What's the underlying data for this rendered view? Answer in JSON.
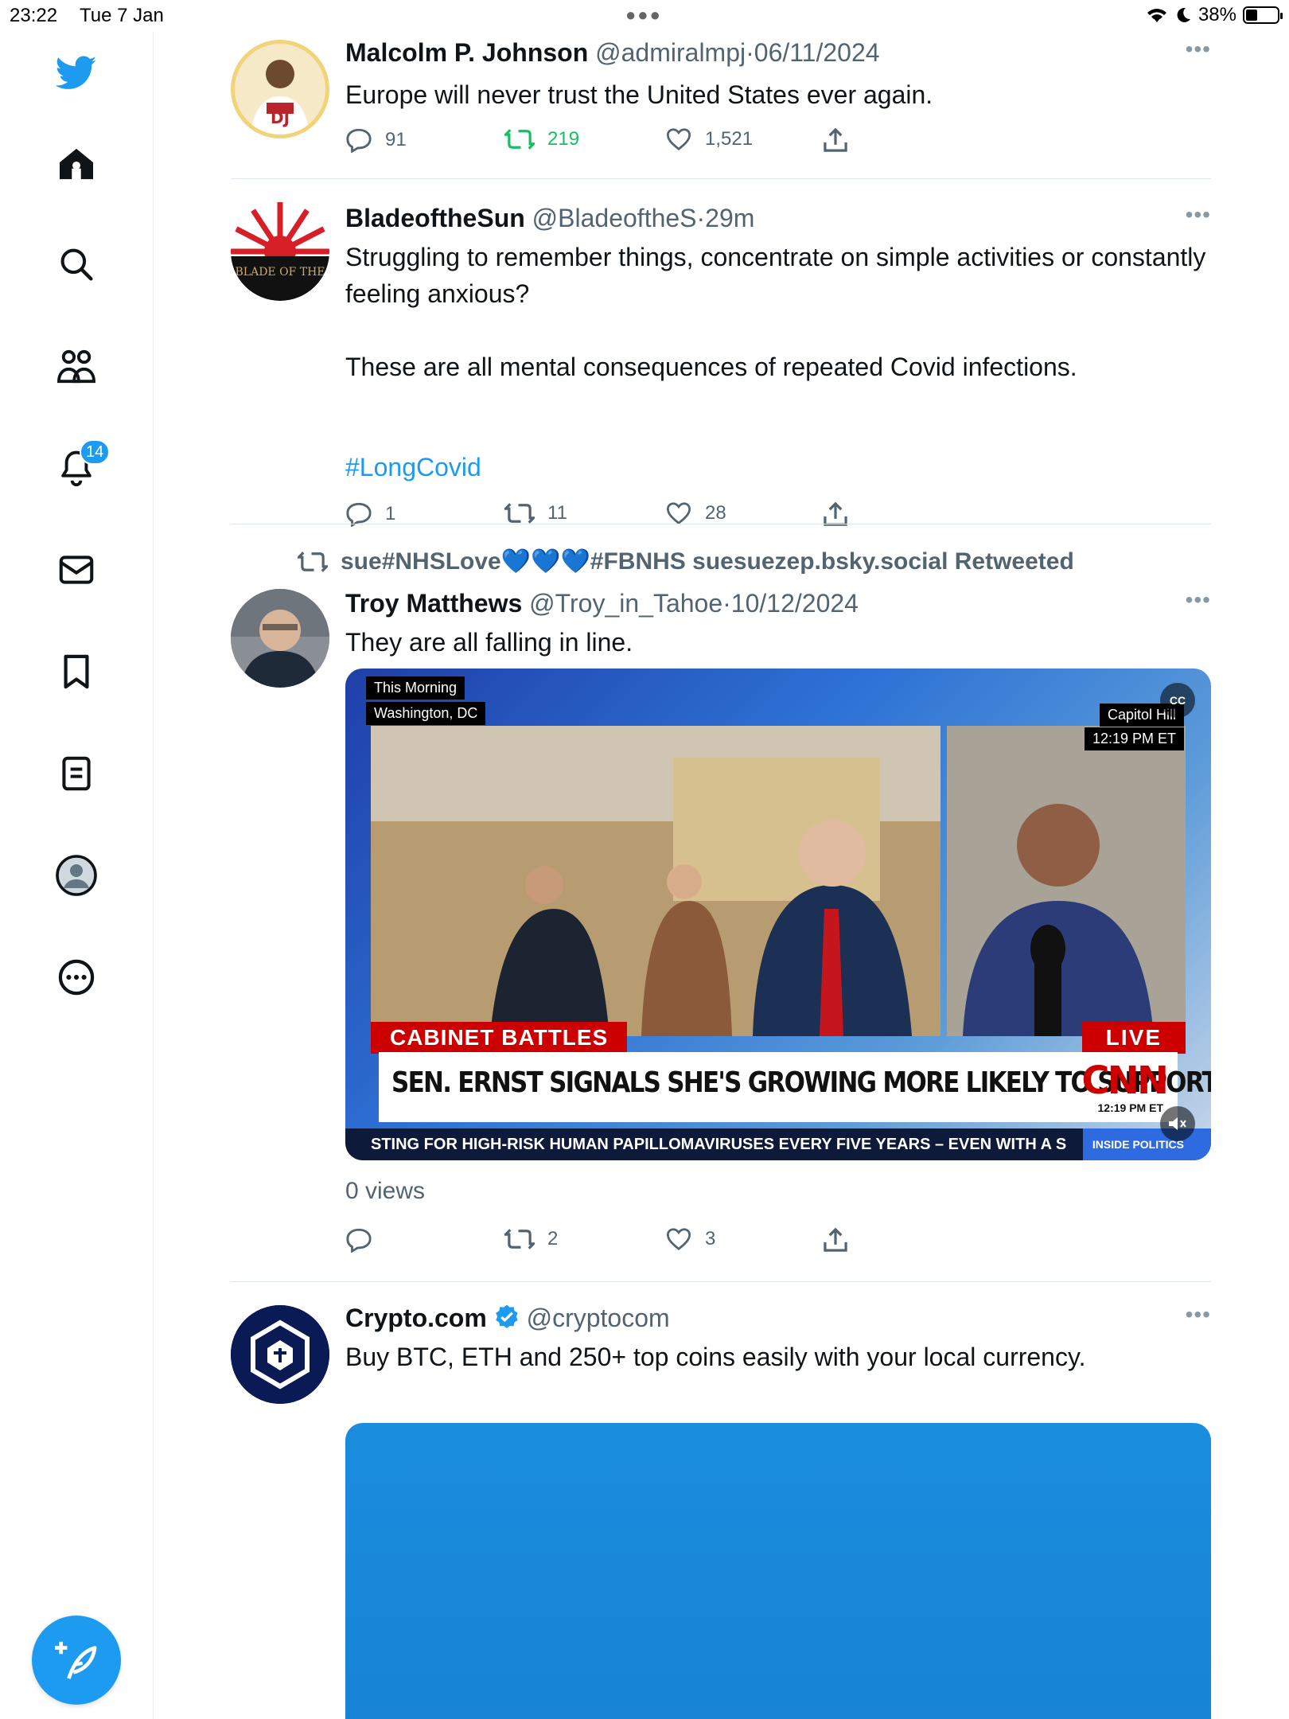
{
  "status_bar": {
    "time": "23:22",
    "date": "Tue 7 Jan",
    "battery": "38%",
    "battery_level": 0.38
  },
  "sidebar": {
    "items": [
      {
        "name": "home"
      },
      {
        "name": "search"
      },
      {
        "name": "communities"
      },
      {
        "name": "notifications",
        "badge": "14"
      },
      {
        "name": "messages"
      },
      {
        "name": "bookmarks"
      },
      {
        "name": "lists"
      },
      {
        "name": "profile"
      },
      {
        "name": "more"
      }
    ],
    "compose_icon": "feather-plus-icon"
  },
  "tweets": [
    {
      "name": "Malcolm P. Johnson",
      "handle": "@admiralmpj",
      "sep": "·",
      "when": "06/11/2024",
      "text": "Europe will never trust the United States ever again.",
      "replies": "91",
      "retweets": "219",
      "likes": "1,521"
    },
    {
      "name": "BladeoftheSun",
      "handle": "@BladeoftheS",
      "sep": "·",
      "when": "29m",
      "text": "Struggling to remember things, concentrate on simple activities or constantly feeling anxious?\n\nThese are all mental consequences of repeated Covid infections.\n\n",
      "hashtag": "#LongCovid",
      "avatar_text": "BLADE OF THE",
      "replies": "1",
      "retweets": "11",
      "likes": "28"
    },
    {
      "retweeted_by": "sue#NHSLove💙💙💙#FBNHS suesuezep.bsky.social Retweeted",
      "name": "Troy Matthews",
      "handle": "@Troy_in_Tahoe",
      "sep": "·",
      "when": "10/12/2024",
      "text": "They are all falling in line.",
      "video": {
        "chip1": "This Morning",
        "chip2": "Washington, DC",
        "loc": "Capitol Hill",
        "time": "12:19 PM ET",
        "cc": "CC",
        "section": "CABINET BATTLES",
        "live": "LIVE",
        "headline": "SEN. ERNST SIGNALS SHE'S GROWING MORE LIKELY TO SUPPORT HEGSETH",
        "network": "CNN",
        "net_time": "12:19 PM ET",
        "ticker": "STING FOR HIGH-RISK HUMAN PAPILLOMAVIRUSES EVERY FIVE YEARS – EVEN WITH A S",
        "show": "INSIDE POLITICS"
      },
      "views": "0 views",
      "replies": "",
      "retweets": "2",
      "likes": "3"
    },
    {
      "name": "Crypto.com",
      "verified": true,
      "handle": "@cryptocom",
      "text": "Buy BTC, ETH and 250+ top coins easily with your local currency."
    }
  ],
  "colors": {
    "accent": "#1d9bf0",
    "retweet_active": "#17bf63",
    "secondary_text": "#536471",
    "cnn_red": "#cc0000"
  }
}
